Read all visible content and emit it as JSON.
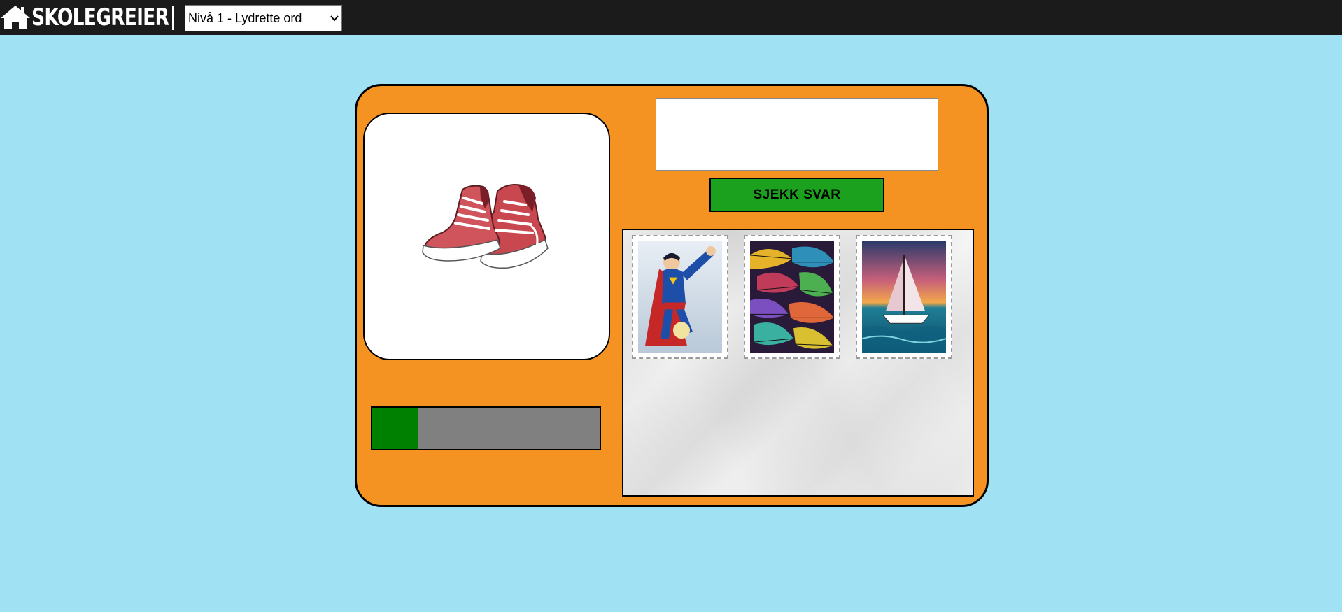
{
  "header": {
    "brand": "SKOLEGREIER",
    "level_select": {
      "selected": "Nivå 1 - Lydrette ord"
    }
  },
  "exercise": {
    "picture_icon": "sneakers-image",
    "answer": {
      "value": "",
      "placeholder": ""
    },
    "check_button_label": "SJEKK SVAR",
    "progress_fraction": 0.2
  },
  "stamps": [
    {
      "icon": "superhero-stamp"
    },
    {
      "icon": "feathers-pattern-stamp"
    },
    {
      "icon": "sailboat-stamp"
    }
  ],
  "colors": {
    "background": "#a0e1f4",
    "topbar": "#1b1b1b",
    "card": "#f59322",
    "check_button": "#1ca11e",
    "progress_fill": "#008000",
    "progress_track": "#808080"
  }
}
